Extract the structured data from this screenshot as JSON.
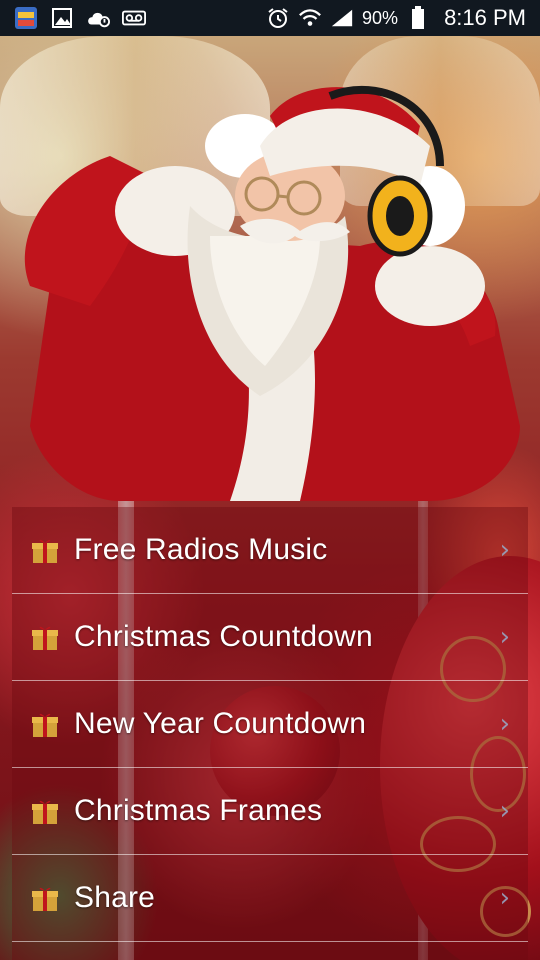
{
  "status_bar": {
    "battery_percent": "90%",
    "time": "8:16 PM",
    "left_icons": [
      "app-icon",
      "image-icon",
      "cloud-alert-icon",
      "voicemail-icon"
    ],
    "right_icons": [
      "alarm-icon",
      "wifi-icon",
      "signal-icon",
      "battery-icon"
    ]
  },
  "menu": {
    "items": [
      {
        "label": "Free Radios Music",
        "icon": "gift-icon"
      },
      {
        "label": "Christmas Countdown",
        "icon": "gift-icon"
      },
      {
        "label": "New Year Countdown",
        "icon": "gift-icon"
      },
      {
        "label": "Christmas Frames",
        "icon": "gift-icon"
      },
      {
        "label": "Share",
        "icon": "gift-icon"
      }
    ]
  },
  "colors": {
    "status_bar_bg": "#111820",
    "menu_overlay": "#6e0a10",
    "santa_red": "#c0141c",
    "headphone_yellow": "#f2b21c"
  }
}
